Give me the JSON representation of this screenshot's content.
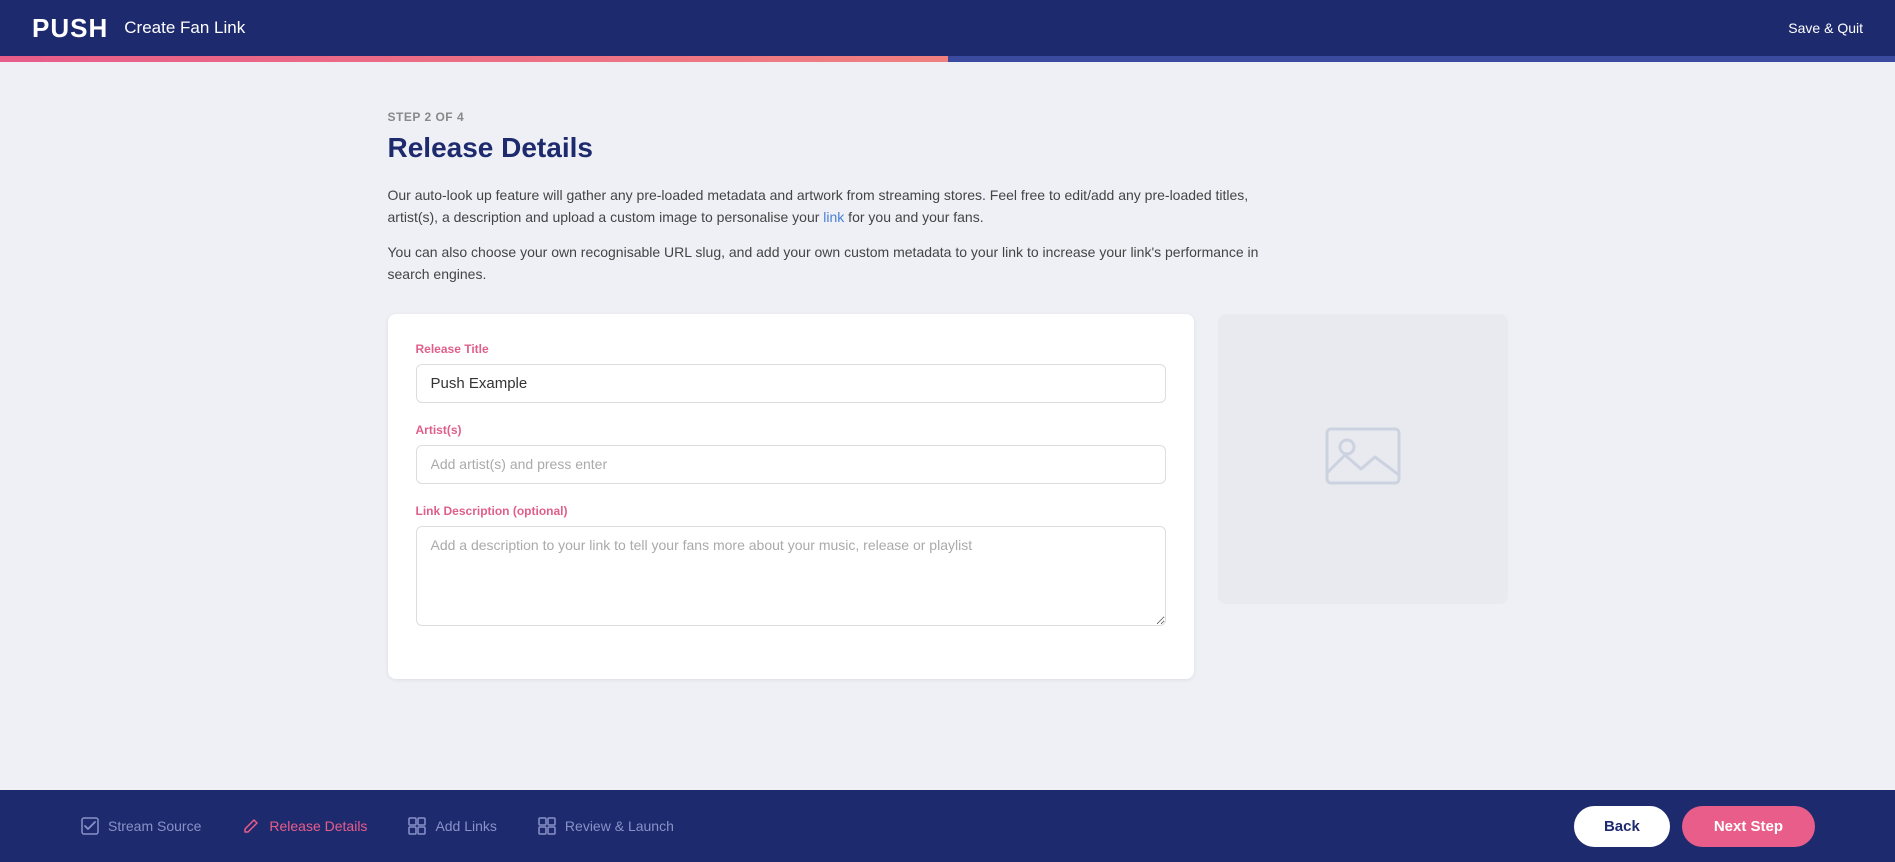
{
  "header": {
    "logo": "PUSH",
    "title": "Create Fan Link",
    "save_quit_label": "Save & Quit"
  },
  "progress": {
    "fill_percent": 50
  },
  "page": {
    "step_label": "STEP 2 OF 4",
    "title": "Release Details",
    "description1": "Our auto-look up feature will gather any pre-loaded metadata and artwork from streaming stores. Feel free to edit/add any pre-loaded titles, artist(s), a description and upload a custom image to personalise your link for you and your fans.",
    "description2": "You can also choose your own recognisable URL slug, and add your own custom metadata to your link to increase your link's performance in search engines."
  },
  "form": {
    "release_title_label": "Release Title",
    "release_title_value": "Push Example",
    "artists_label": "Artist(s)",
    "artists_placeholder": "Add artist(s) and press enter",
    "description_label": "Link Description (optional)",
    "description_placeholder": "Add a description to your link to tell your fans more about your music, release or playlist"
  },
  "footer": {
    "steps": [
      {
        "id": "stream-source",
        "label": "Stream Source",
        "state": "completed",
        "icon": "check-square"
      },
      {
        "id": "release-details",
        "label": "Release Details",
        "state": "active",
        "icon": "edit"
      },
      {
        "id": "add-links",
        "label": "Add Links",
        "state": "inactive",
        "icon": "grid"
      },
      {
        "id": "review-launch",
        "label": "Review & Launch",
        "state": "inactive",
        "icon": "grid"
      }
    ],
    "back_label": "Back",
    "next_label": "Next Step"
  }
}
